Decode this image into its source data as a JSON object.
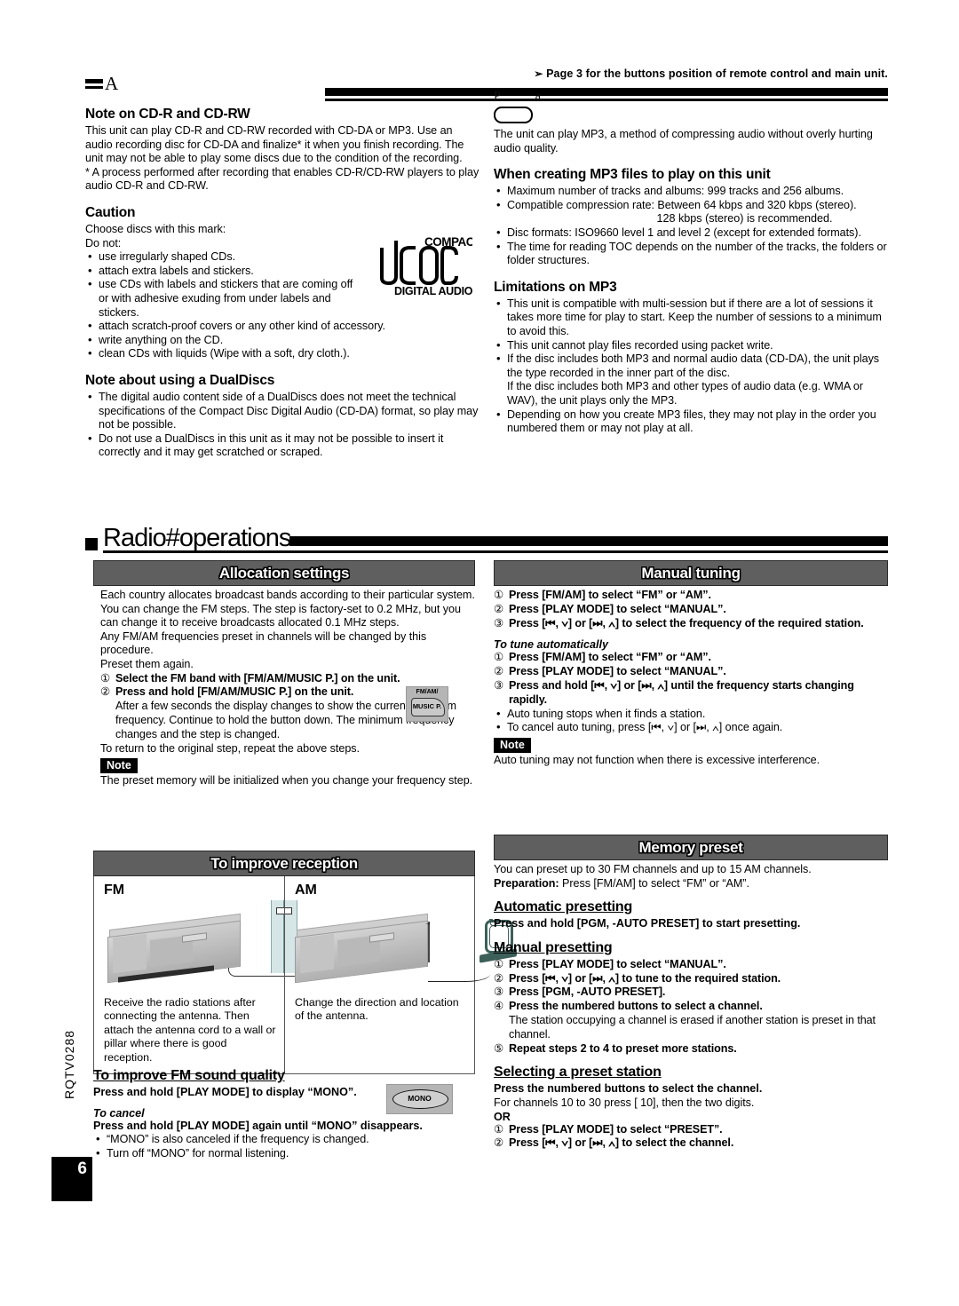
{
  "header": {
    "arrow": "➡",
    "page_ref": "Page 3 for the buttons position of remote control and main unit.",
    "ghost_text": "P a"
  },
  "marker": {
    "letter": "A"
  },
  "cd_section": {
    "title": "Note on CD-R and CD-RW",
    "body": "This unit can play CD-R and CD-RW recorded with CD-DA or MP3. Use an audio recording disc for CD-DA and finalize* it when you finish recording. The unit may not be able to play some discs due to the condition of the recording.",
    "footnote": "* A process performed after recording that enables CD-R/CD-RW players to play audio CD-R and CD-RW."
  },
  "caution": {
    "title": "Caution",
    "line1": "Choose discs with this mark:",
    "line2": "Do not:",
    "items": [
      "use irregularly shaped CDs.",
      "attach extra labels and stickers.",
      "use CDs with labels and stickers that are coming off or with adhesive exuding from under labels and stickers.",
      "attach scratch-proof covers or any other kind of accessory.",
      "write anything on the CD.",
      "clean CDs with liquids (Wipe with a soft, dry cloth.)."
    ]
  },
  "cd_logo": {
    "line1": "COMPACT",
    "line2": "disc",
    "line3": "DIGITAL AUDIO"
  },
  "dualdisc": {
    "title": "Note about using a DualDiscs",
    "items": [
      "The digital audio content side of a DualDiscs does not meet the technical specifications of the Compact Disc Digital Audio (CD-DA) format, so play may not be possible.",
      "Do not use a DualDiscs in this unit as it may not be possible to insert it correctly and it may get scratched or scraped."
    ]
  },
  "mp3": {
    "badge_label": "",
    "intro": "The unit can play MP3, a method of compressing audio without overly hurting audio quality.",
    "creating_title": "When creating MP3 files to play on this unit",
    "creating_items": [
      "Maximum number of tracks and albums: 999 tracks and 256 albums.",
      "Compatible compression rate: Between 64 kbps and 320 kbps (stereo).",
      "Disc formats: ISO9660 level 1 and level 2 (except for extended formats).",
      "The time for reading TOC depends on the number of the tracks, the folders or folder structures."
    ],
    "recommended_line": "128 kbps (stereo) is recommended.",
    "limits_title": "Limitations on MP3",
    "limits_items": [
      "This unit is compatible with multi-session but if there are a lot of sessions it takes more time for play to start. Keep the number of sessions to a minimum to avoid this.",
      "This unit cannot play files recorded using packet write.",
      "If the disc includes both MP3 and normal audio data (CD-DA), the unit plays the type recorded in the inner part of the disc.\nIf the disc includes both MP3 and other types of audio data (e.g. WMA or WAV), the unit plays only the MP3.",
      "Depending on how you create MP3 files, they may not play in the order you numbered them or may not play at all."
    ]
  },
  "radio_section": {
    "title": "Radio#operations"
  },
  "allocation": {
    "bar_title": "Allocation settings",
    "p1": "Each country allocates broadcast bands according to their particular system.",
    "p2": "You can change the FM steps. The step is factory-set to 0.2 MHz, but you can change it to receive broadcasts allocated 0.1 MHz steps.",
    "p3": "Any FM/AM frequencies preset in channels will be changed by this procedure.",
    "p4": "Preset them again.",
    "steps": [
      {
        "num": "①",
        "text": "Select the FM band with [FM/AM/MUSIC P.] on the unit."
      },
      {
        "num": "②",
        "text": "Press and hold [FM/AM/MUSIC P.] on the unit.",
        "sub": "After a few seconds the display changes to show the current minimum frequency. Continue to hold the button down. The minimum frequency changes and the step is changed."
      }
    ],
    "p5": "To return to the original step, repeat the above steps.",
    "note_label": "Note",
    "note_text": "The preset memory will be initialized when you change your frequency step.",
    "button_art": {
      "top": "FM/AM/",
      "bottom": "MUSIC P."
    }
  },
  "manual_tuning": {
    "bar_title": "Manual tuning",
    "steps": [
      {
        "num": "①",
        "text": "Press [FM/AM] to select “FM” or “AM”."
      },
      {
        "num": "②",
        "text": "Press [PLAY MODE] to select “MANUAL”."
      },
      {
        "num": "③",
        "text": "Press [⏮, ∨] or [⏭, ∧] to select the frequency of the required station."
      }
    ],
    "auto_title": "To tune automatically",
    "auto_steps": [
      {
        "num": "①",
        "text": "Press [FM/AM] to select “FM” or “AM”."
      },
      {
        "num": "②",
        "text": "Press [PLAY MODE] to select “MANUAL”."
      },
      {
        "num": "③",
        "text": "Press and hold [⏮, ∨] or [⏭, ∧] until the frequency starts changing rapidly."
      }
    ],
    "bullets": [
      "Auto tuning stops when it finds a station.",
      "To cancel auto tuning, press [⏮, ∨] or [⏭, ∧] once again."
    ],
    "note_label": "Note",
    "note_text": "Auto tuning may not function when there is excessive interference."
  },
  "reception": {
    "bar_title": "To improve reception",
    "fm_label": "FM",
    "am_label": "AM",
    "fm_text": "Receive the radio stations after connecting the antenna. Then attach the antenna cord to a wall or pillar where there is good reception.",
    "am_text": "Change the direction and location of the antenna."
  },
  "fm_sound": {
    "title": "To improve FM sound quality",
    "line1": "Press and hold [PLAY MODE] to display “MONO”.",
    "cancel_title": "To cancel",
    "cancel_line": "Press and hold [PLAY MODE] again until “MONO” disappears.",
    "bullets": [
      "“MONO” is also canceled if the frequency is changed.",
      "Turn off “MONO” for normal listening."
    ],
    "button_art": {
      "label": "MONO"
    }
  },
  "memory_preset": {
    "bar_title": "Memory preset",
    "intro": "You can preset up to 30 FM channels and up to 15 AM channels.",
    "prep_label": "Preparation:",
    "prep_text": " Press [FM/AM] to select “FM” or “AM”.",
    "auto_title": "Automatic presetting",
    "auto_line": "Press and hold [PGM, -AUTO PRESET] to start presetting.",
    "manual_title": "Manual presetting",
    "manual_steps": [
      {
        "num": "①",
        "text": "Press [PLAY MODE] to select “MANUAL”."
      },
      {
        "num": "②",
        "text": "Press [⏮, ∨] or [⏭, ∧] to tune to the required station."
      },
      {
        "num": "③",
        "text": "Press [PGM, -AUTO PRESET]."
      },
      {
        "num": "④",
        "text": "Press the numbered buttons to select a channel.",
        "sub": "The station occupying a channel is erased if another station is preset in that channel."
      },
      {
        "num": "⑤",
        "text": "Repeat steps 2 to 4 to preset more stations."
      }
    ],
    "select_title": "Selecting a preset station",
    "select_line1": "Press the numbered buttons to select the channel.",
    "select_line2": "For channels 10 to 30 press [ 10], then the two digits.",
    "or_label": "OR",
    "select_steps": [
      {
        "num": "①",
        "text": "Press [PLAY MODE] to select “PRESET”."
      },
      {
        "num": "②",
        "text": "Press [⏮, ∨] or [⏭, ∧] to select the channel."
      }
    ]
  },
  "footer": {
    "code": "RQTV0288",
    "page_number": "6"
  },
  "colors": {
    "section_bar": "#5f5f5f",
    "page_badge": "#000000"
  }
}
